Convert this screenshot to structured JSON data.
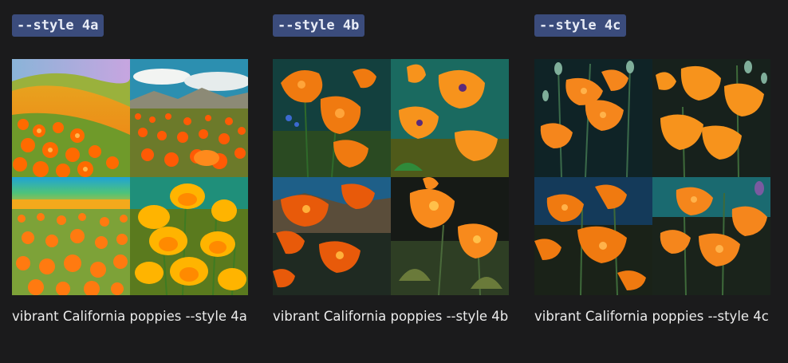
{
  "columns": [
    {
      "tag": "--style 4a",
      "caption": "vibrant California poppies --style 4a",
      "image_alt": "4 generated images of vibrant California poppies, style 4a"
    },
    {
      "tag": "--style 4b",
      "caption": "vibrant California poppies --style 4b",
      "image_alt": "4 generated images of vibrant California poppies, style 4b"
    },
    {
      "tag": "--style 4c",
      "caption": "vibrant California poppies --style 4c",
      "image_alt": "4 generated images of vibrant California poppies, style 4c"
    }
  ],
  "colors": {
    "background": "#1b1b1c",
    "tag_background": "#3b4c7c",
    "tag_text": "#e8ecf6",
    "caption_text": "#ececec",
    "poppy_orange": "#f5861c"
  }
}
